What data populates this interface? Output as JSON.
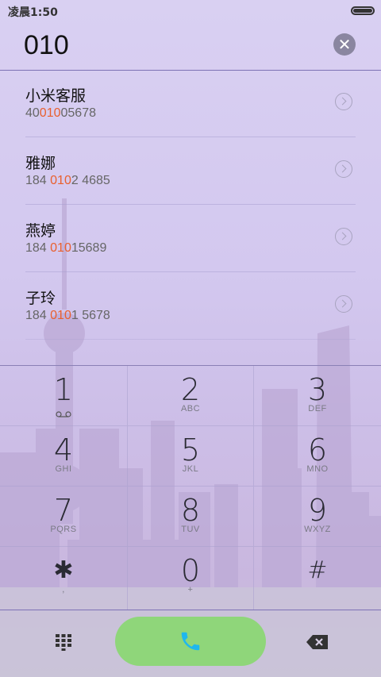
{
  "status_bar": {
    "time": "凌晨1:50"
  },
  "dial": {
    "number": "010",
    "clear_icon": "close-circle-icon"
  },
  "contacts": [
    {
      "name": "小米客服",
      "number_pre": "40",
      "number_match": "010",
      "number_post": "05678"
    },
    {
      "name": "雅娜",
      "number_pre": "184 ",
      "number_match": "010",
      "number_post": "2 4685"
    },
    {
      "name": "燕婷",
      "number_pre": "184 ",
      "number_match": "010",
      "number_post": "15689"
    },
    {
      "name": "子玲",
      "number_pre": "184 ",
      "number_match": "010",
      "number_post": "1 5678"
    }
  ],
  "keypad": {
    "rows": [
      [
        {
          "digit": "1",
          "letters": ""
        },
        {
          "digit": "2",
          "letters": "ABC"
        },
        {
          "digit": "3",
          "letters": "DEF"
        }
      ],
      [
        {
          "digit": "4",
          "letters": "GHI"
        },
        {
          "digit": "5",
          "letters": "JKL"
        },
        {
          "digit": "6",
          "letters": "MNO"
        }
      ],
      [
        {
          "digit": "7",
          "letters": "PQRS"
        },
        {
          "digit": "8",
          "letters": "TUV"
        },
        {
          "digit": "9",
          "letters": "WXYZ"
        }
      ],
      [
        {
          "digit": "✱",
          "letters": ","
        },
        {
          "digit": "0",
          "letters": "+"
        },
        {
          "digit": "#",
          "letters": ""
        }
      ]
    ]
  },
  "colors": {
    "highlight": "#e9602e",
    "call_button": "#8fd67a",
    "call_icon": "#1fb7ee"
  },
  "icons": {
    "dialpad": "dialpad-grid-icon",
    "call": "phone-icon",
    "backspace": "backspace-icon",
    "voicemail": "voicemail-icon"
  }
}
